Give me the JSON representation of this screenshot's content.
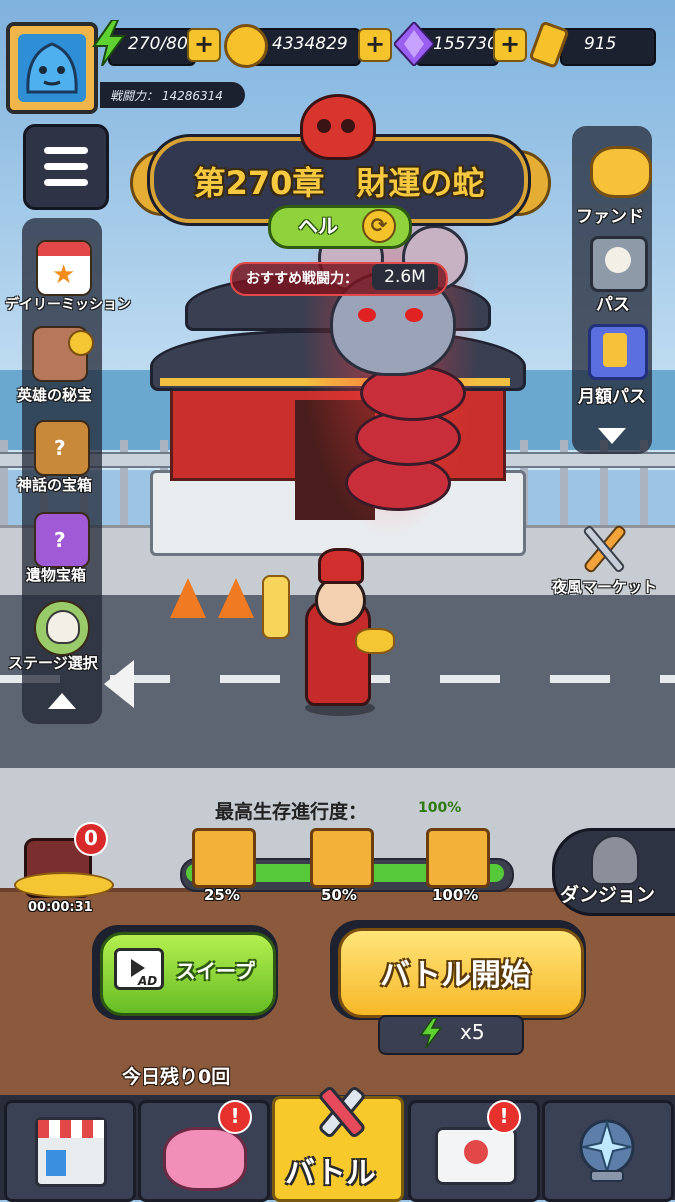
{
  "hud": {
    "stamina": "270/80",
    "gold": "4334829",
    "gems": "155730",
    "tickets": "915",
    "power_label": "戦闘力：",
    "power_value": "14286314"
  },
  "chapter": {
    "title": "第270章　財運の蛇",
    "difficulty": "ヘル",
    "recommended_label": "おすすめ戦闘力：",
    "recommended_value": "2.6M"
  },
  "left_menu": [
    {
      "label": "デイリーミッション",
      "icon": "calendar-star-icon"
    },
    {
      "label": "英雄の秘宝",
      "icon": "hero-treasure-icon"
    },
    {
      "label": "神話の宝箱",
      "icon": "myth-chest-icon"
    },
    {
      "label": "遺物宝箱",
      "icon": "relic-chest-icon"
    },
    {
      "label": "ステージ選択",
      "icon": "skull-stage-icon"
    }
  ],
  "right_menu": [
    {
      "label": "ファンド",
      "icon": "piggy-bank-icon"
    },
    {
      "label": "パス",
      "icon": "skull-pass-icon"
    },
    {
      "label": "月額パス",
      "icon": "monthly-pass-icon"
    }
  ],
  "night_market": "夜風マーケット",
  "dungeon": "ダンジョン",
  "idle_reward": {
    "timer": "00:00:31",
    "badge": "0"
  },
  "progress": {
    "title": "最高生存進行度：",
    "value": "100%",
    "percent": 100,
    "milestones": [
      "25%",
      "50%",
      "100%"
    ]
  },
  "buttons": {
    "sweep": "スイープ",
    "ad": "AD",
    "start": "バトル開始",
    "cost": "x5",
    "remaining": "今日残り0回"
  },
  "nav": {
    "battle_label": "バトル",
    "badge": "!"
  },
  "colors": {
    "accent_gold": "#f7c940",
    "accent_green": "#67bd25",
    "alert_red": "#e7312d"
  }
}
